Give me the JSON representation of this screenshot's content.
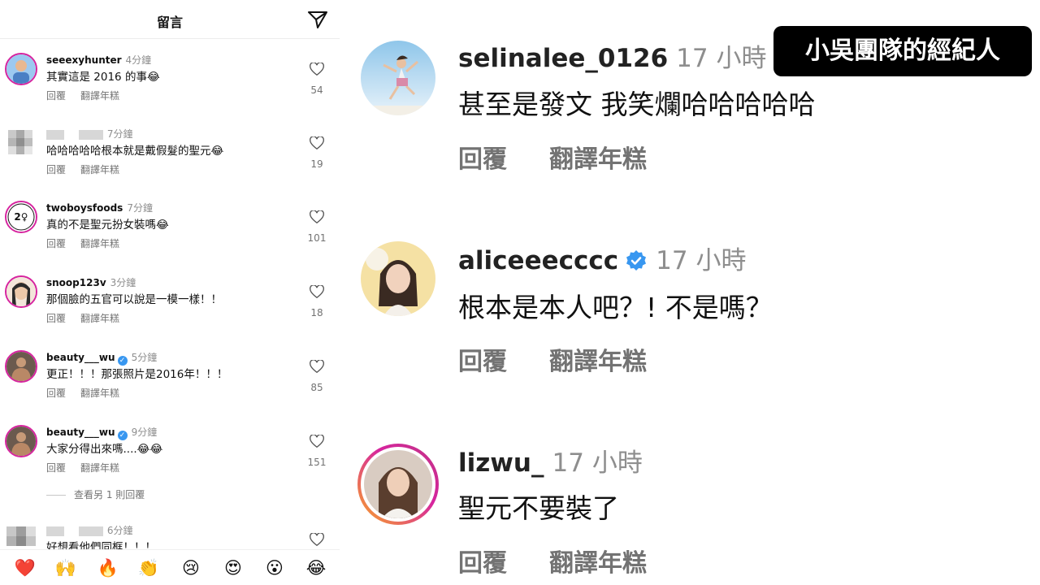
{
  "left_panel": {
    "header": {
      "title": "留言"
    },
    "comments": [
      {
        "username": "seeexyhunter",
        "time": "4分鐘",
        "text": "其實這是 2016 的事",
        "emoji": "😂",
        "reply": "回覆",
        "translate": "翻譯年糕",
        "likes": "54"
      },
      {
        "username": "",
        "time": "7分鐘",
        "text": "哈哈哈哈哈根本就是戴假髮的聖元",
        "emoji": "😂",
        "reply": "回覆",
        "translate": "翻譯年糕",
        "likes": "19"
      },
      {
        "username": "twoboysfoods",
        "time": "7分鐘",
        "text": "真的不是聖元扮女裝嗎",
        "emoji": "😂",
        "reply": "回覆",
        "translate": "翻譯年糕",
        "likes": "101"
      },
      {
        "username": "snoop123v",
        "time": "3分鐘",
        "text": "那個臉的五官可以說是一模一樣！！",
        "emoji": "",
        "reply": "回覆",
        "translate": "翻譯年糕",
        "likes": "18"
      },
      {
        "username": "beauty___wu",
        "time": "5分鐘",
        "text": "更正！！！那張照片是2016年！！！",
        "emoji": "",
        "reply": "回覆",
        "translate": "翻譯年糕",
        "likes": "85"
      },
      {
        "username": "beauty___wu",
        "time": "9分鐘",
        "text": "大家分得出來嗎....",
        "emoji": "😂😂",
        "reply": "回覆",
        "translate": "翻譯年糕",
        "likes": "151"
      },
      {
        "username": "",
        "time": "6分鐘",
        "text": "好想看他們同框！！！",
        "emoji": "",
        "reply": "",
        "translate": "",
        "likes": ""
      }
    ],
    "view_more_replies": "查看另 1 則回覆",
    "emoji_bar": [
      "❤️",
      "🙌",
      "🔥",
      "👏",
      "😢",
      "😍",
      "😮",
      "😂"
    ]
  },
  "right_panel": {
    "banner": "小吳團隊的經紀人",
    "comments": [
      {
        "username": "selinalee_0126",
        "time": "17 小時",
        "text": "甚至是發文 我笑爛哈哈哈哈哈",
        "reply": "回覆",
        "translate": "翻譯年糕",
        "verified": false
      },
      {
        "username": "aliceeecccc",
        "time": "17 小時",
        "text": "根本是本人吧？! 不是嗎？",
        "reply": "回覆",
        "translate": "翻譯年糕",
        "verified": true
      },
      {
        "username": "lizwu_",
        "time": "17 小時",
        "text": "聖元不要裝了",
        "reply": "回覆",
        "translate": "翻譯年糕",
        "verified": false
      }
    ]
  },
  "colors": {
    "verified_blue": "#3897f0",
    "muted_text": "#8e8e8e",
    "story_ring_start": "#f9a825",
    "story_ring_end": "#d6249f"
  }
}
